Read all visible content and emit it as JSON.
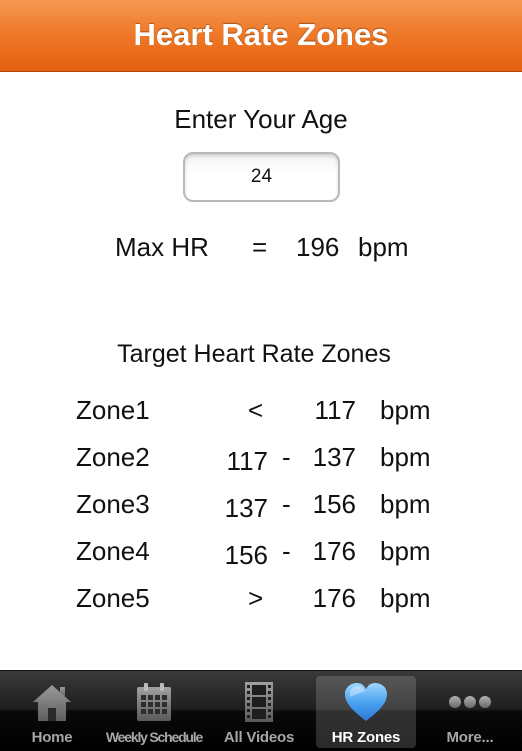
{
  "header": {
    "title": "Heart Rate Zones"
  },
  "age": {
    "label": "Enter Your Age",
    "value": "24"
  },
  "max_hr": {
    "label": "Max HR",
    "equals": "=",
    "value": "196",
    "unit": "bpm"
  },
  "zones": {
    "title": "Target Heart Rate Zones",
    "rows": [
      {
        "name": "Zone1",
        "low": "",
        "sep": "<",
        "high": "117",
        "unit": "bpm"
      },
      {
        "name": "Zone2",
        "low": "117",
        "sep": "-",
        "high": "137",
        "unit": "bpm"
      },
      {
        "name": "Zone3",
        "low": "137",
        "sep": "-",
        "high": "156",
        "unit": "bpm"
      },
      {
        "name": "Zone4",
        "low": "156",
        "sep": "-",
        "high": "176",
        "unit": "bpm"
      },
      {
        "name": "Zone5",
        "low": "",
        "sep": ">",
        "high": "176",
        "unit": "bpm"
      }
    ]
  },
  "tab_bar": {
    "selected": "HR Zones",
    "tabs": [
      {
        "label": "Home",
        "icon": "home-icon"
      },
      {
        "label": "Weekly Schedule",
        "icon": "calendar-icon"
      },
      {
        "label": "All Videos",
        "icon": "film-icon"
      },
      {
        "label": "HR Zones",
        "icon": "heart-icon"
      },
      {
        "label": "More...",
        "icon": "more-icon"
      }
    ]
  },
  "colors": {
    "header_orange": "#ef7a2a",
    "selected_heart": "#4aa3f0"
  }
}
